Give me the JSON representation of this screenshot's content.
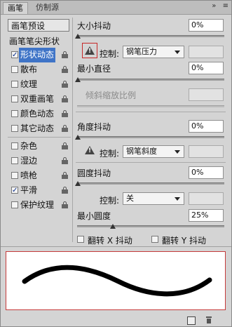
{
  "tabs": [
    "画笔",
    "仿制源"
  ],
  "panel_menu_icons": [
    "collapse-icon",
    "panel-menu-icon"
  ],
  "brush_presets_label": "画笔预设",
  "settings_list": [
    {
      "label": "画笔笔尖形状",
      "checkbox": false,
      "lock": false
    },
    {
      "label": "形状动态",
      "checkbox": true,
      "checked": true,
      "lock": true,
      "selected": true
    },
    {
      "label": "散布",
      "checkbox": true,
      "checked": false,
      "lock": true
    },
    {
      "label": "纹理",
      "checkbox": true,
      "checked": false,
      "lock": true
    },
    {
      "label": "双重画笔",
      "checkbox": true,
      "checked": false,
      "lock": true
    },
    {
      "label": "颜色动态",
      "checkbox": true,
      "checked": false,
      "lock": true
    },
    {
      "label": "其它动态",
      "checkbox": true,
      "checked": false,
      "lock": true
    },
    {
      "label": "杂色",
      "checkbox": true,
      "checked": false,
      "lock": true
    },
    {
      "label": "湿边",
      "checkbox": true,
      "checked": false,
      "lock": true
    },
    {
      "label": "喷枪",
      "checkbox": true,
      "checked": false,
      "lock": true
    },
    {
      "label": "平滑",
      "checkbox": true,
      "checked": true,
      "lock": true
    },
    {
      "label": "保护纹理",
      "checkbox": true,
      "checked": false,
      "lock": true
    }
  ],
  "size_jitter": {
    "label": "大小抖动",
    "value": "0%",
    "slider_level": 0.0
  },
  "control_label": "控制:",
  "size_control": {
    "value": "钢笔压力"
  },
  "min_diameter": {
    "label": "最小直径",
    "value": "0%",
    "slider_level": 0.0
  },
  "tilt_scale": {
    "label": "倾斜缩放比例"
  },
  "angle_jitter": {
    "label": "角度抖动",
    "value": "0%",
    "slider_level": 0.0
  },
  "angle_control": {
    "value": "钢笔斜度"
  },
  "roundness_jitter": {
    "label": "圆度抖动",
    "value": "0%",
    "slider_level": 0.0
  },
  "roundness_control": {
    "value": "关"
  },
  "min_roundness": {
    "label": "最小圆度",
    "value": "25%",
    "slider_level": 0.25
  },
  "flip_x": {
    "label": "翻转 X 抖动",
    "checked": false
  },
  "flip_y": {
    "label": "翻转 Y 抖动",
    "checked": false
  },
  "footer_icons": [
    "new-brush-icon",
    "delete-icon"
  ]
}
